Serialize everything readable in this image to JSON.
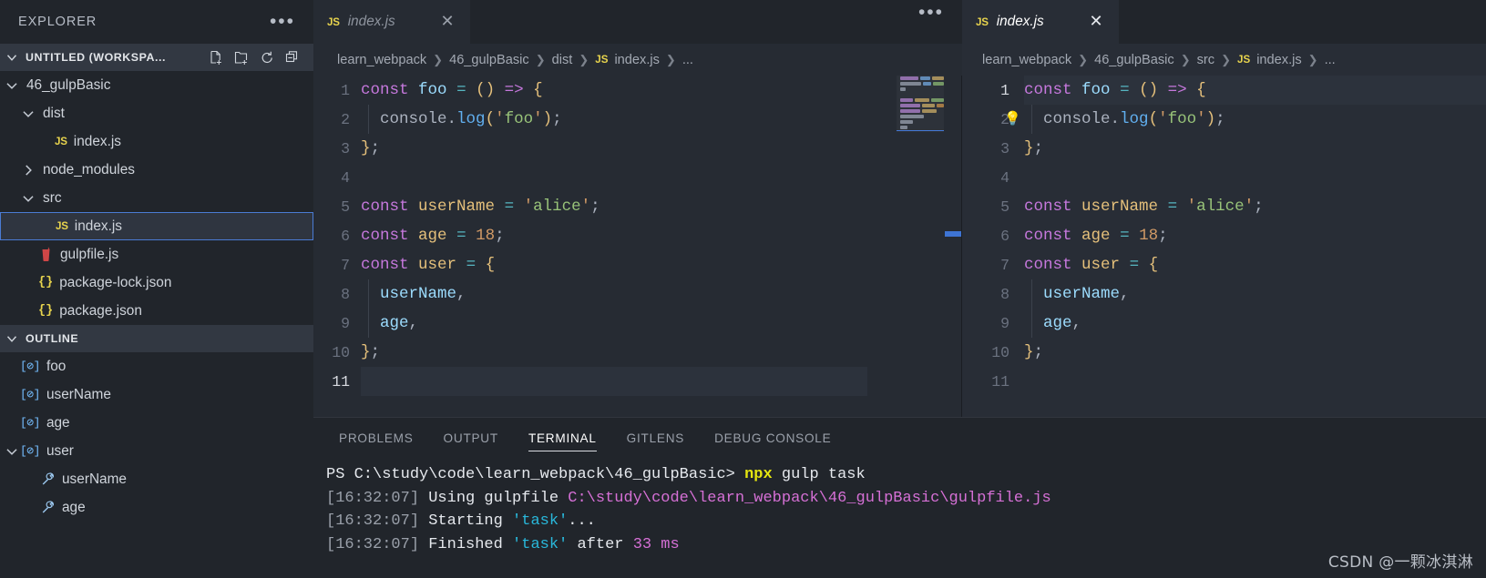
{
  "sidebar": {
    "title": "EXPLORER",
    "more_icon": "ellipsis-icon",
    "workspace": {
      "label": "UNTITLED (WORKSPA...",
      "actions": [
        {
          "name": "new-file-icon",
          "title": "New File"
        },
        {
          "name": "new-folder-icon",
          "title": "New Folder"
        },
        {
          "name": "refresh-icon",
          "title": "Refresh Explorer"
        },
        {
          "name": "collapse-all-icon",
          "title": "Collapse Folders"
        }
      ]
    },
    "tree": [
      {
        "label": "46_gulpBasic",
        "kind": "folder",
        "depth": 1,
        "expanded": true,
        "icon": "chevron-down-icon"
      },
      {
        "label": "dist",
        "kind": "folder",
        "depth": 2,
        "expanded": true,
        "icon": "chevron-down-icon"
      },
      {
        "label": "index.js",
        "kind": "js",
        "depth": 3,
        "icon": "js-file-icon"
      },
      {
        "label": "node_modules",
        "kind": "folder",
        "depth": 2,
        "expanded": false,
        "icon": "chevron-right-icon"
      },
      {
        "label": "src",
        "kind": "folder",
        "depth": 2,
        "expanded": true,
        "icon": "chevron-down-icon"
      },
      {
        "label": "index.js",
        "kind": "js",
        "depth": 3,
        "icon": "js-file-icon",
        "selected": true
      },
      {
        "label": "gulpfile.js",
        "kind": "gulp",
        "depth": 2,
        "icon": "gulp-file-icon"
      },
      {
        "label": "package-lock.json",
        "kind": "json",
        "depth": 2,
        "icon": "json-file-icon"
      },
      {
        "label": "package.json",
        "kind": "json",
        "depth": 2,
        "icon": "json-file-icon"
      }
    ],
    "outline": {
      "label": "OUTLINE",
      "items": [
        {
          "label": "foo",
          "kind": "variable",
          "depth": 1,
          "icon": "variable-icon"
        },
        {
          "label": "userName",
          "kind": "variable",
          "depth": 1,
          "icon": "variable-icon"
        },
        {
          "label": "age",
          "kind": "variable",
          "depth": 1,
          "icon": "variable-icon"
        },
        {
          "label": "user",
          "kind": "variable",
          "depth": 1,
          "icon": "variable-icon",
          "expanded": true
        },
        {
          "label": "userName",
          "kind": "property",
          "depth": 2,
          "icon": "property-icon"
        },
        {
          "label": "age",
          "kind": "property",
          "depth": 2,
          "icon": "property-icon"
        }
      ]
    }
  },
  "editor_groups": [
    {
      "tab": {
        "js_badge": "JS",
        "label": "index.js",
        "close_icon": "close-icon",
        "active": false,
        "preview": true
      },
      "more_icon": "ellipsis-icon",
      "breadcrumb": [
        "learn_webpack",
        "46_gulpBasic",
        "dist",
        "index.js",
        "..."
      ],
      "breadcrumb_file_badge": "JS",
      "current_line": 11,
      "lightbulb": null,
      "lines": [
        {
          "n": 1,
          "tokens": [
            [
              "kw",
              "const"
            ],
            [
              "pun",
              " "
            ],
            [
              "id",
              "foo"
            ],
            [
              "pun",
              " "
            ],
            [
              "op",
              "="
            ],
            [
              "pun",
              " "
            ],
            [
              "par",
              "()"
            ],
            [
              "pun",
              " "
            ],
            [
              "arw",
              "=>"
            ],
            [
              "pun",
              " "
            ],
            [
              "brc",
              "{"
            ]
          ]
        },
        {
          "n": 2,
          "indent": true,
          "tokens": [
            [
              "pun",
              "  "
            ],
            [
              "obj",
              "console"
            ],
            [
              "pun",
              "."
            ],
            [
              "mem",
              "log"
            ],
            [
              "par",
              "("
            ],
            [
              "qt",
              "'"
            ],
            [
              "str",
              "foo"
            ],
            [
              "qt",
              "'"
            ],
            [
              "par",
              ")"
            ],
            [
              "semi",
              ";"
            ]
          ]
        },
        {
          "n": 3,
          "tokens": [
            [
              "brc",
              "}"
            ],
            [
              "semi",
              ";"
            ]
          ]
        },
        {
          "n": 4,
          "tokens": []
        },
        {
          "n": 5,
          "tokens": [
            [
              "kw",
              "const"
            ],
            [
              "pun",
              " "
            ],
            [
              "var",
              "userName"
            ],
            [
              "pun",
              " "
            ],
            [
              "op",
              "="
            ],
            [
              "pun",
              " "
            ],
            [
              "qt",
              "'"
            ],
            [
              "str",
              "alice"
            ],
            [
              "qt",
              "'"
            ],
            [
              "semi",
              ";"
            ]
          ]
        },
        {
          "n": 6,
          "tokens": [
            [
              "kw",
              "const"
            ],
            [
              "pun",
              " "
            ],
            [
              "var",
              "age"
            ],
            [
              "pun",
              " "
            ],
            [
              "op",
              "="
            ],
            [
              "pun",
              " "
            ],
            [
              "num",
              "18"
            ],
            [
              "semi",
              ";"
            ]
          ]
        },
        {
          "n": 7,
          "tokens": [
            [
              "kw",
              "const"
            ],
            [
              "pun",
              " "
            ],
            [
              "var",
              "user"
            ],
            [
              "pun",
              " "
            ],
            [
              "op",
              "="
            ],
            [
              "pun",
              " "
            ],
            [
              "brc",
              "{"
            ]
          ]
        },
        {
          "n": 8,
          "indent": true,
          "tokens": [
            [
              "pun",
              "  "
            ],
            [
              "id",
              "userName"
            ],
            [
              "pun",
              ","
            ]
          ]
        },
        {
          "n": 9,
          "indent": true,
          "tokens": [
            [
              "pun",
              "  "
            ],
            [
              "id",
              "age"
            ],
            [
              "pun",
              ","
            ]
          ]
        },
        {
          "n": 10,
          "tokens": [
            [
              "brc",
              "}"
            ],
            [
              "semi",
              ";"
            ]
          ]
        },
        {
          "n": 11,
          "tokens": []
        }
      ]
    },
    {
      "tab": {
        "js_badge": "JS",
        "label": "index.js",
        "close_icon": "close-icon",
        "active": true,
        "preview": true
      },
      "breadcrumb": [
        "learn_webpack",
        "46_gulpBasic",
        "src",
        "index.js",
        "..."
      ],
      "breadcrumb_file_badge": "JS",
      "current_line": 1,
      "lightbulb": {
        "line": 2,
        "icon": "lightbulb-icon"
      },
      "lines": [
        {
          "n": 1,
          "tokens": [
            [
              "kw",
              "const"
            ],
            [
              "pun",
              " "
            ],
            [
              "id",
              "foo"
            ],
            [
              "pun",
              " "
            ],
            [
              "op",
              "="
            ],
            [
              "pun",
              " "
            ],
            [
              "par",
              "()"
            ],
            [
              "pun",
              " "
            ],
            [
              "arw",
              "=>"
            ],
            [
              "pun",
              " "
            ],
            [
              "brc",
              "{"
            ]
          ]
        },
        {
          "n": 2,
          "indent": true,
          "tokens": [
            [
              "pun",
              "  "
            ],
            [
              "obj",
              "console"
            ],
            [
              "pun",
              "."
            ],
            [
              "mem",
              "log"
            ],
            [
              "par",
              "("
            ],
            [
              "qt",
              "'"
            ],
            [
              "str",
              "foo"
            ],
            [
              "qt",
              "'"
            ],
            [
              "par",
              ")"
            ],
            [
              "semi",
              ";"
            ]
          ]
        },
        {
          "n": 3,
          "tokens": [
            [
              "brc",
              "}"
            ],
            [
              "semi",
              ";"
            ]
          ]
        },
        {
          "n": 4,
          "tokens": []
        },
        {
          "n": 5,
          "tokens": [
            [
              "kw",
              "const"
            ],
            [
              "pun",
              " "
            ],
            [
              "var",
              "userName"
            ],
            [
              "pun",
              " "
            ],
            [
              "op",
              "="
            ],
            [
              "pun",
              " "
            ],
            [
              "qt",
              "'"
            ],
            [
              "str",
              "alice"
            ],
            [
              "qt",
              "'"
            ],
            [
              "semi",
              ";"
            ]
          ]
        },
        {
          "n": 6,
          "tokens": [
            [
              "kw",
              "const"
            ],
            [
              "pun",
              " "
            ],
            [
              "var",
              "age"
            ],
            [
              "pun",
              " "
            ],
            [
              "op",
              "="
            ],
            [
              "pun",
              " "
            ],
            [
              "num",
              "18"
            ],
            [
              "semi",
              ";"
            ]
          ]
        },
        {
          "n": 7,
          "tokens": [
            [
              "kw",
              "const"
            ],
            [
              "pun",
              " "
            ],
            [
              "var",
              "user"
            ],
            [
              "pun",
              " "
            ],
            [
              "op",
              "="
            ],
            [
              "pun",
              " "
            ],
            [
              "brc",
              "{"
            ]
          ]
        },
        {
          "n": 8,
          "indent": true,
          "tokens": [
            [
              "pun",
              "  "
            ],
            [
              "id",
              "userName"
            ],
            [
              "pun",
              ","
            ]
          ]
        },
        {
          "n": 9,
          "indent": true,
          "tokens": [
            [
              "pun",
              "  "
            ],
            [
              "id",
              "age"
            ],
            [
              "pun",
              ","
            ]
          ]
        },
        {
          "n": 10,
          "tokens": [
            [
              "brc",
              "}"
            ],
            [
              "semi",
              ";"
            ]
          ]
        },
        {
          "n": 11,
          "tokens": []
        }
      ]
    }
  ],
  "panel": {
    "tabs": [
      {
        "label": "PROBLEMS",
        "active": false
      },
      {
        "label": "OUTPUT",
        "active": false
      },
      {
        "label": "TERMINAL",
        "active": true
      },
      {
        "label": "GITLENS",
        "active": false
      },
      {
        "label": "DEBUG CONSOLE",
        "active": false
      }
    ],
    "terminal_lines": [
      [
        [
          "t-white",
          "PS C:\\study\\code\\learn_webpack\\46_gulpBasic> "
        ],
        [
          "t-yellow",
          "npx"
        ],
        [
          "t-white",
          " gulp task"
        ]
      ],
      [
        [
          "t-ts",
          "[16:32:07] "
        ],
        [
          "t-white",
          "Using gulpfile "
        ],
        [
          "t-mag",
          "C:\\study\\code\\learn_webpack\\46_gulpBasic\\gulpfile.js"
        ]
      ],
      [
        [
          "t-ts",
          "[16:32:07] "
        ],
        [
          "t-white",
          "Starting "
        ],
        [
          "t-cyan",
          "'task'"
        ],
        [
          "t-white",
          "..."
        ]
      ],
      [
        [
          "t-ts",
          "[16:32:07] "
        ],
        [
          "t-white",
          "Finished "
        ],
        [
          "t-cyan",
          "'task'"
        ],
        [
          "t-white",
          " after "
        ],
        [
          "t-mag",
          "33"
        ],
        [
          "t-white",
          " "
        ],
        [
          "t-mag",
          "ms"
        ]
      ]
    ]
  },
  "watermark": "CSDN @一颗冰淇淋",
  "colors": {
    "sidebar_bg": "#21252b",
    "editor_bg": "#262b33",
    "editor_bg_active": "#282d36",
    "selection_border": "#4a7bd4",
    "js_yellow": "#e8d44d",
    "keyword": "#c678dd",
    "string": "#98c379",
    "number": "#d19a66",
    "variable": "#e5c07b",
    "identifier": "#9cdcfe",
    "terminal_magenta": "#d670d6",
    "terminal_cyan": "#29b8db"
  }
}
